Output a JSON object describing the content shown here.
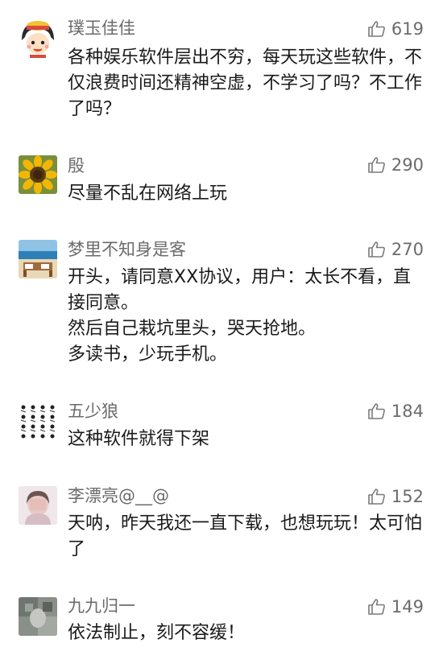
{
  "comments": [
    {
      "username": "璞玉佳佳",
      "likes": "619",
      "avatar_icon": "cartoon-girl-avatar",
      "lines": [
        "各种娱乐软件层出不穷，每天玩这些软件，不仅浪费时间还精神空虚，不学习了吗？不工作了吗？"
      ]
    },
    {
      "username": "殷",
      "likes": "290",
      "avatar_icon": "sunflower-avatar",
      "lines": [
        "尽量不乱在网络上玩"
      ]
    },
    {
      "username": "梦里不知身是客",
      "likes": "270",
      "avatar_icon": "beach-avatar",
      "lines": [
        "开头，请同意XX协议，用户：太长不看，直接同意。",
        "然后自己栽坑里头，哭天抢地。",
        "多读书，少玩手机。"
      ]
    },
    {
      "username": "五少狼",
      "likes": "184",
      "avatar_icon": "pattern-avatar",
      "lines": [
        "这种软件就得下架"
      ]
    },
    {
      "username": "李漂亮@__@",
      "likes": "152",
      "avatar_icon": "blurred-portrait-avatar",
      "lines": [
        "天呐，昨天我还一直下载，也想玩玩！太可怕了"
      ]
    },
    {
      "username": "九九归一",
      "likes": "149",
      "avatar_icon": "blurred-photo-avatar",
      "lines": [
        "依法制止，刻不容缓！"
      ]
    }
  ]
}
